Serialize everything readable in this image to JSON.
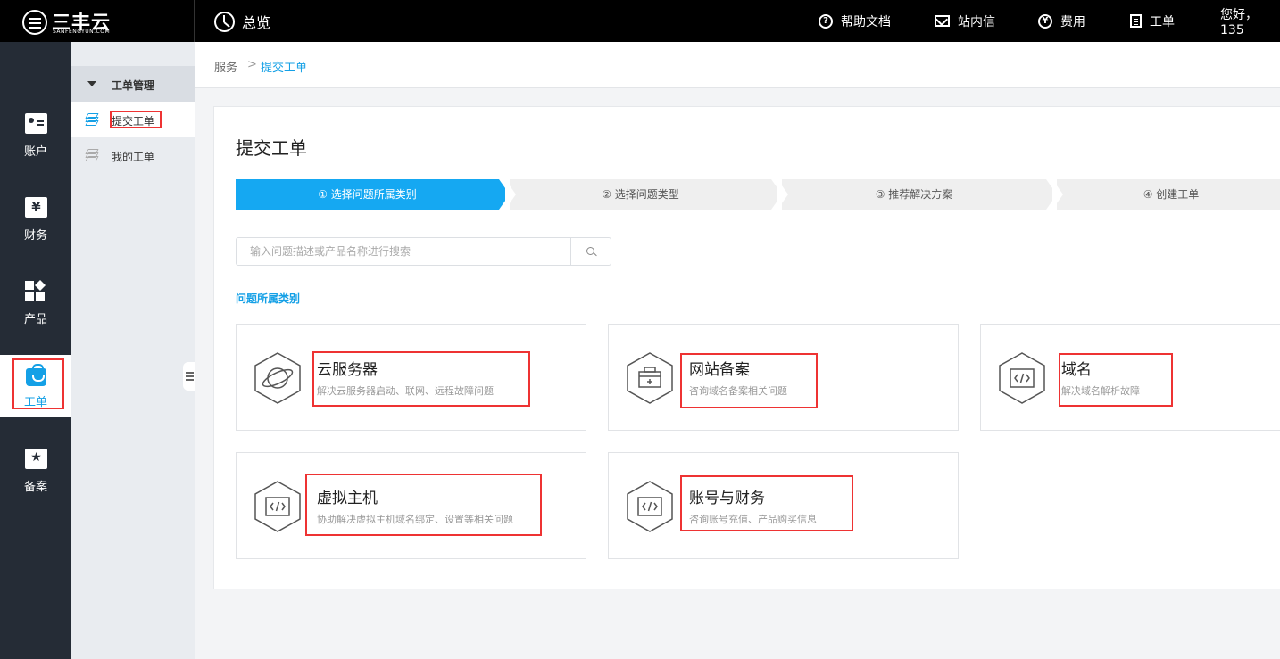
{
  "brand": {
    "logo_text": "三丰云",
    "logo_sub": "SANFENGYUN.COM"
  },
  "header": {
    "overview": "总览",
    "nav": [
      {
        "label": "帮助文档",
        "icon": "help-circle-icon",
        "glyph": "?"
      },
      {
        "label": "站内信",
        "icon": "mail-icon"
      },
      {
        "label": "费用",
        "icon": "yen-circle-icon",
        "glyph": "¥"
      },
      {
        "label": "工单",
        "icon": "document-icon"
      }
    ],
    "greeting": "您好，135"
  },
  "leftnav": {
    "items": [
      {
        "label": "账户",
        "icon": "account-card-icon"
      },
      {
        "label": "财务",
        "icon": "finance-yen-icon",
        "glyph": "¥"
      },
      {
        "label": "产品",
        "icon": "product-grid-icon"
      },
      {
        "label": "工单",
        "icon": "ticket-bag-icon",
        "active": true
      },
      {
        "label": "备案",
        "icon": "filing-star-icon",
        "glyph": "★"
      }
    ]
  },
  "subnav": {
    "header": "工单管理",
    "items": [
      {
        "label": "提交工单",
        "icon": "layers-icon",
        "active": true
      },
      {
        "label": "我的工单",
        "icon": "layers-icon"
      }
    ]
  },
  "breadcrumb": {
    "parent": "服务",
    "separator": ">",
    "current": "提交工单"
  },
  "page": {
    "title": "提交工单",
    "steps": [
      {
        "label": "① 选择问题所属类别",
        "active": true
      },
      {
        "label": "② 选择问题类型"
      },
      {
        "label": "③ 推荐解决方案"
      },
      {
        "label": "④ 创建工单"
      }
    ],
    "search": {
      "placeholder": "输入问题描述或产品名称进行搜索",
      "value": ""
    },
    "section_label": "问题所属类别",
    "categories": [
      {
        "title": "云服务器",
        "desc": "解决云服务器启动、联网、远程故障问题",
        "icon": "planet-icon"
      },
      {
        "title": "网站备案",
        "desc": "咨询域名备案相关问题",
        "icon": "toolbox-icon"
      },
      {
        "title": "域名",
        "desc": "解决域名解析故障",
        "icon": "code-icon"
      },
      {
        "title": "虚拟主机",
        "desc": "协助解决虚拟主机域名绑定、设置等相关问题",
        "icon": "code-icon"
      },
      {
        "title": "账号与财务",
        "desc": "咨询账号充值、产品购买信息",
        "icon": "code-icon"
      }
    ]
  },
  "colors": {
    "accent": "#14a0e6",
    "step_active": "#15a8f2",
    "annotation_red": "#ee3333",
    "topbar": "#000000",
    "sidebar": "#252c36"
  }
}
